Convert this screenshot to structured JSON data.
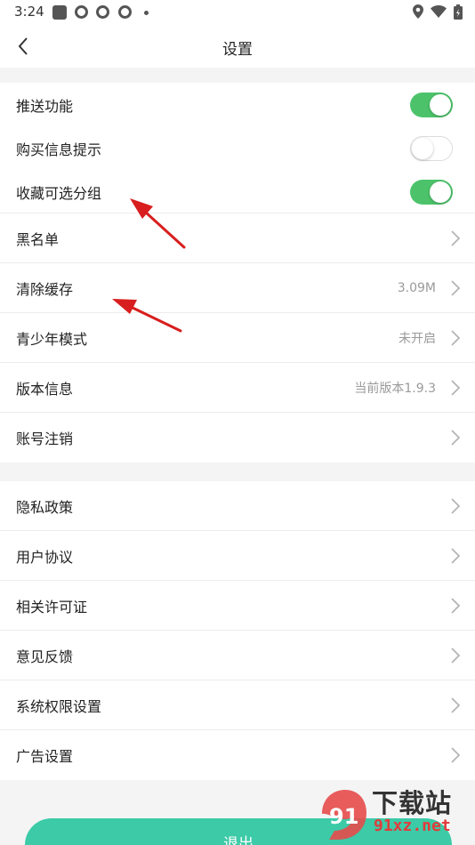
{
  "status_bar": {
    "time": "3:24"
  },
  "header": {
    "title": "设置"
  },
  "toggles": [
    {
      "label": "推送功能",
      "on": true
    },
    {
      "label": "购买信息提示",
      "on": false
    },
    {
      "label": "收藏可选分组",
      "on": true
    }
  ],
  "group1": [
    {
      "label": "黑名单",
      "value": ""
    },
    {
      "label": "清除缓存",
      "value": "3.09M"
    },
    {
      "label": "青少年模式",
      "value": "未开启"
    },
    {
      "label": "版本信息",
      "value": "当前版本1.9.3"
    },
    {
      "label": "账号注销",
      "value": ""
    }
  ],
  "group2": [
    {
      "label": "隐私政策"
    },
    {
      "label": "用户协议"
    },
    {
      "label": "相关许可证"
    },
    {
      "label": "意见反馈"
    },
    {
      "label": "系统权限设置"
    },
    {
      "label": "广告设置"
    }
  ],
  "logout_label": "退出",
  "watermark": {
    "top": "下载站",
    "bottom": "91xz.net",
    "logo": "91"
  },
  "colors": {
    "toggle_on": "#4cc36a",
    "logout": "#3ccaa7",
    "annotation": "#d81e1e"
  }
}
